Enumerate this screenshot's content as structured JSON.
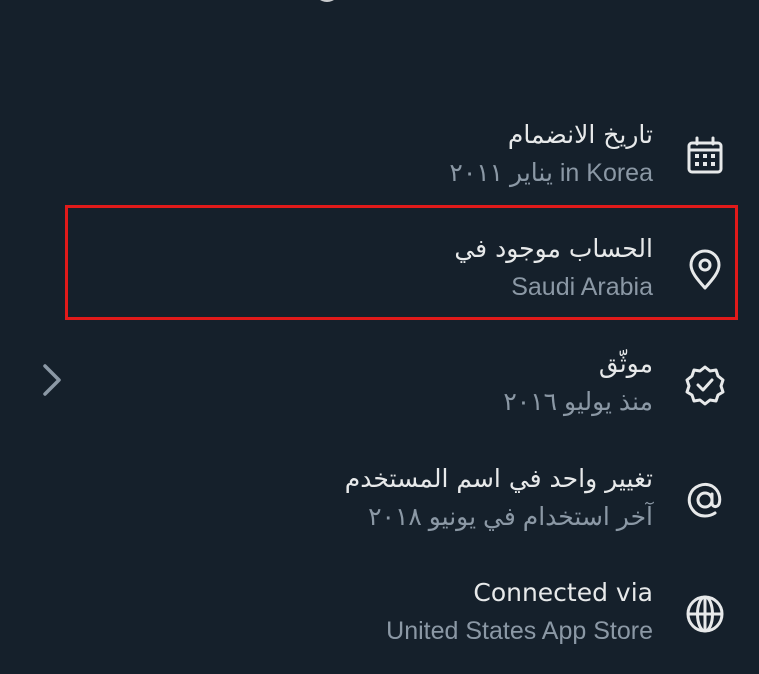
{
  "colors": {
    "background": "#15202b",
    "primary_text": "#e7e9ea",
    "secondary_text": "#8b98a5",
    "highlight_border": "#e11a1a"
  },
  "rows": [
    {
      "id": "joined",
      "title": "تاريخ الانضمام",
      "subtitle": "in Korea يناير ٢٠١١",
      "icon": "calendar-icon"
    },
    {
      "id": "location",
      "title": "الحساب موجود في",
      "subtitle": "Saudi Arabia",
      "icon": "location-pin-icon",
      "highlighted": true
    },
    {
      "id": "verified",
      "title": "موثّق",
      "subtitle": "منذ يوليو ٢٠١٦",
      "icon": "verified-badge-icon",
      "has_chevron": true
    },
    {
      "id": "username",
      "title": "تغيير واحد في اسم المستخدم",
      "subtitle": "آخر استخدام في يونيو ٢٠١٨",
      "icon": "at-sign-icon"
    },
    {
      "id": "connected",
      "title": "Connected via",
      "subtitle": "United States App Store",
      "icon": "globe-icon"
    }
  ]
}
